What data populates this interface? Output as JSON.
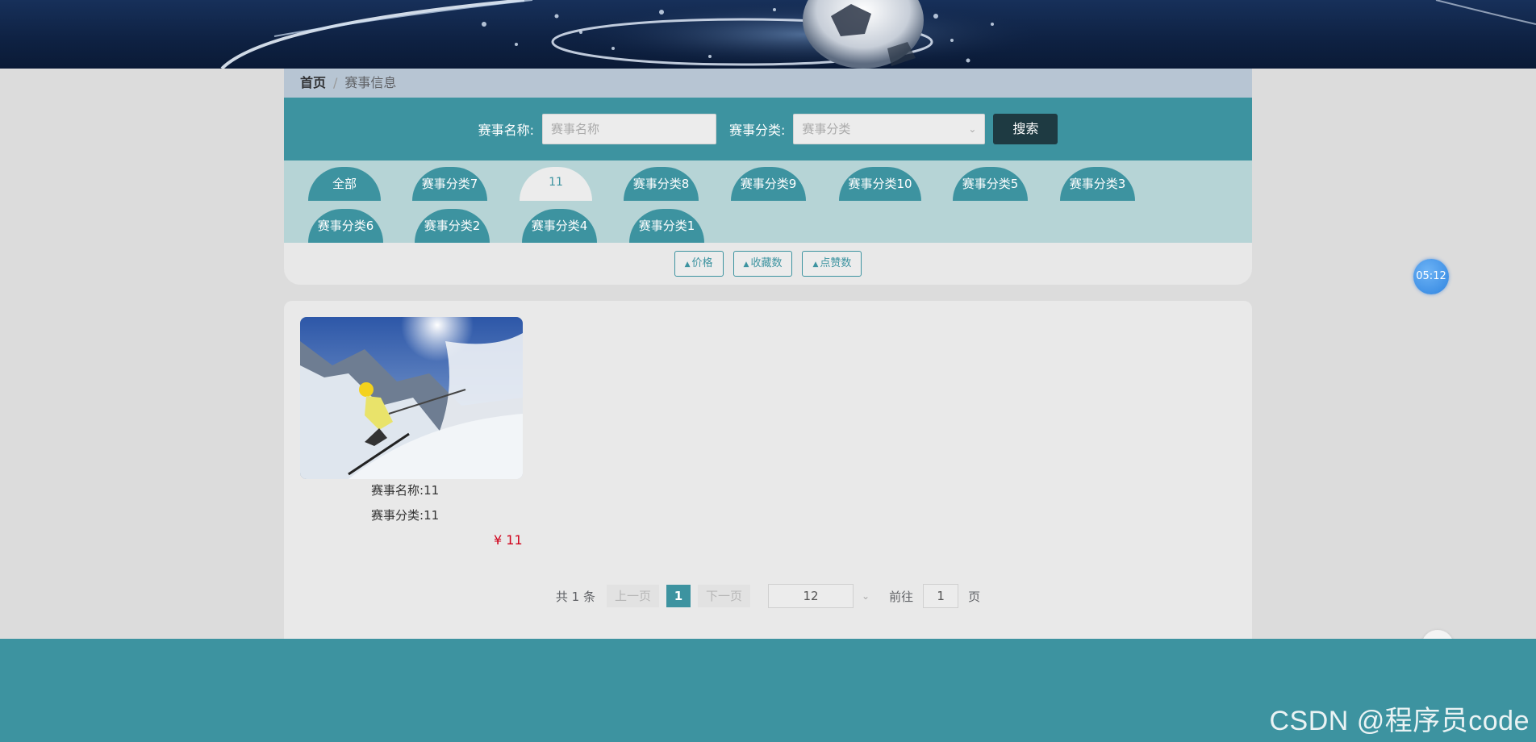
{
  "breadcrumb": {
    "home": "首页",
    "separator": "/",
    "current": "赛事信息"
  },
  "search": {
    "name_label": "赛事名称:",
    "name_placeholder": "赛事名称",
    "category_label": "赛事分类:",
    "category_placeholder": "赛事分类",
    "button": "搜索"
  },
  "categories": [
    {
      "label": "全部",
      "active": false
    },
    {
      "label": "赛事分类7",
      "active": false
    },
    {
      "label": "11",
      "active": true
    },
    {
      "label": "赛事分类8",
      "active": false
    },
    {
      "label": "赛事分类9",
      "active": false
    },
    {
      "label": "赛事分类10",
      "active": false
    },
    {
      "label": "赛事分类5",
      "active": false
    },
    {
      "label": "赛事分类3",
      "active": false
    },
    {
      "label": "赛事分类6",
      "active": false
    },
    {
      "label": "赛事分类2",
      "active": false
    },
    {
      "label": "赛事分类4",
      "active": false
    },
    {
      "label": "赛事分类1",
      "active": false
    }
  ],
  "sort": {
    "price": "价格",
    "favorites": "收藏数",
    "likes": "点赞数"
  },
  "items": [
    {
      "name_label": "赛事名称:",
      "name": "11",
      "category_label": "赛事分类:",
      "category": "11",
      "price": "¥ 11",
      "image": "skier-photo"
    }
  ],
  "pagination": {
    "total": "共 1 条",
    "prev": "上一页",
    "current": "1",
    "next": "下一页",
    "page_size": "12",
    "goto_label": "前往",
    "goto_value": "1",
    "page_unit": "页"
  },
  "timer": "05:12",
  "watermark": "CSDN @程序员code",
  "colors": {
    "primary": "#3d93a0",
    "dark_button": "#1e3a42",
    "price": "#d0021b"
  }
}
